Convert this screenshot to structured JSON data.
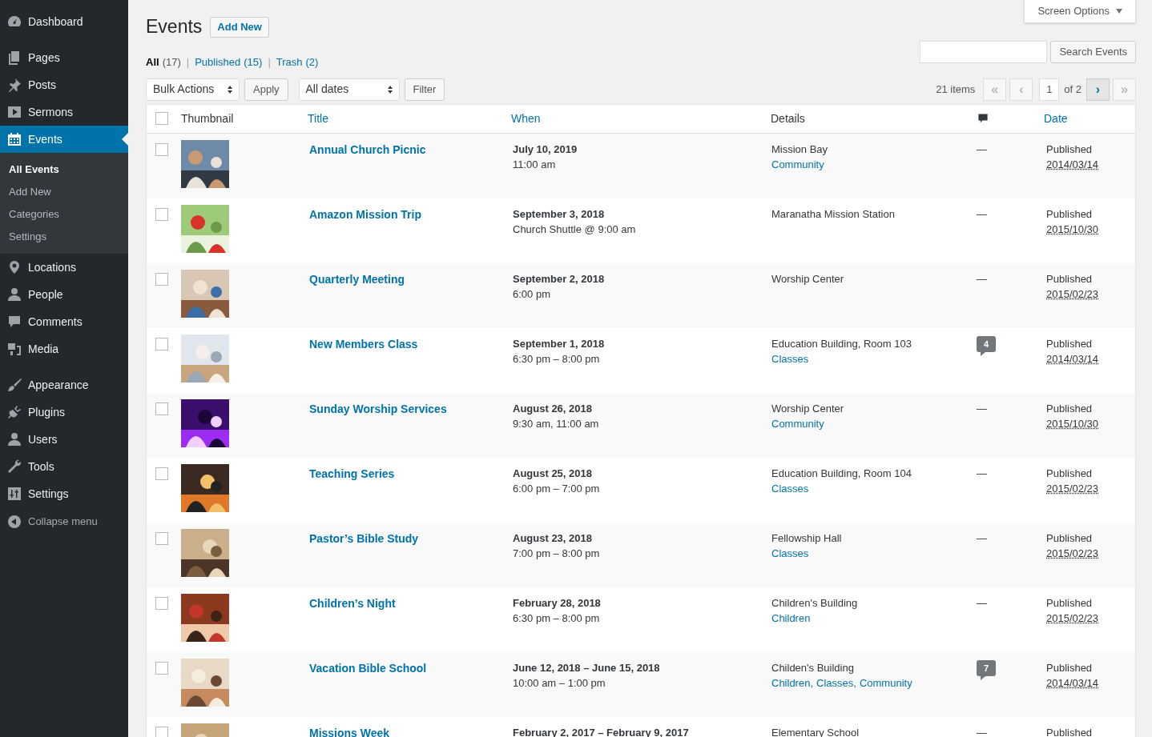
{
  "sidebar": {
    "groups": [
      [
        {
          "label": "Dashboard",
          "selected": false
        }
      ],
      [
        {
          "label": "Pages",
          "selected": false
        },
        {
          "label": "Posts",
          "selected": false
        },
        {
          "label": "Sermons",
          "selected": false
        },
        {
          "label": "Events",
          "selected": true,
          "submenu": [
            {
              "label": "All Events",
              "selected": true
            },
            {
              "label": "Add New",
              "selected": false
            },
            {
              "label": "Categories",
              "selected": false
            },
            {
              "label": "Settings",
              "selected": false
            }
          ]
        },
        {
          "label": "Locations",
          "selected": false
        },
        {
          "label": "People",
          "selected": false
        },
        {
          "label": "Comments",
          "selected": false
        },
        {
          "label": "Media",
          "selected": false
        }
      ],
      [
        {
          "label": "Appearance",
          "selected": false
        },
        {
          "label": "Plugins",
          "selected": false
        },
        {
          "label": "Users",
          "selected": false
        },
        {
          "label": "Tools",
          "selected": false
        },
        {
          "label": "Settings",
          "selected": false
        }
      ]
    ],
    "collapse": "Collapse menu"
  },
  "screen_options": "Screen Options",
  "title": "Events",
  "add_new": "Add New",
  "views": [
    {
      "label": "All",
      "count": "(17)",
      "selected": true,
      "separator": "|"
    },
    {
      "label": "Published",
      "count": "(15)",
      "selected": false,
      "separator": "|"
    },
    {
      "label": "Trash",
      "count": "(2)",
      "selected": false
    }
  ],
  "select_all_checked": false,
  "search_button": "Search Events",
  "bulk_actions": "Bulk Actions",
  "apply": "Apply",
  "dates": "All dates",
  "filter": "Filter",
  "pagination": {
    "items": "21 items",
    "page": "1",
    "of": "of 2",
    "buttons": [
      {
        "label": "«",
        "disabled": true
      },
      {
        "label": "‹",
        "disabled": true
      },
      {
        "label": "›",
        "disabled": false
      },
      {
        "label": "»",
        "disabled": true
      }
    ]
  },
  "columns": {
    "thumbnail": "Thumbnail",
    "title": "Title",
    "when": "When",
    "details": "Details",
    "date": "Date"
  },
  "rows": [
    {
      "checked": false,
      "title": "Annual Church Picnic",
      "when": [
        "July 10, 2019",
        "11:00 am"
      ],
      "location": "Mission Bay",
      "categories": [
        {
          "label": "Community"
        }
      ],
      "comments": {
        "kind": "dash",
        "text": "—"
      },
      "status": "Published",
      "date": "2014/03/14"
    },
    {
      "checked": false,
      "title": "Amazon Mission Trip",
      "when": [
        "September 3, 2018",
        "Church Shuttle @ 9:00 am"
      ],
      "location": "Maranatha Mission Station",
      "categories": [],
      "comments": {
        "kind": "dash",
        "text": "—"
      },
      "status": "Published",
      "date": "2015/10/30"
    },
    {
      "checked": false,
      "title": "Quarterly Meeting",
      "when": [
        "September 2, 2018",
        "6:00 pm"
      ],
      "location": "Worship Center",
      "categories": [],
      "comments": {
        "kind": "dash",
        "text": "—"
      },
      "status": "Published",
      "date": "2015/02/23"
    },
    {
      "checked": false,
      "title": "New Members Class",
      "when": [
        "September 1, 2018",
        "6:30 pm – 8:00 pm"
      ],
      "location": "Education Building, Room 103",
      "categories": [
        {
          "label": "Classes"
        }
      ],
      "comments": {
        "kind": "bubble",
        "text": "4"
      },
      "status": "Published",
      "date": "2014/03/14"
    },
    {
      "checked": false,
      "title": "Sunday Worship Services",
      "when": [
        "August 26, 2018",
        "9:30 am, 11:00 am"
      ],
      "location": "Worship Center",
      "categories": [
        {
          "label": "Community"
        }
      ],
      "comments": {
        "kind": "dash",
        "text": "—"
      },
      "status": "Published",
      "date": "2015/10/30"
    },
    {
      "checked": false,
      "title": "Teaching Series",
      "when": [
        "August 25, 2018",
        "6:00 pm – 7:00 pm"
      ],
      "location": "Education Building, Room 104",
      "categories": [
        {
          "label": "Classes"
        }
      ],
      "comments": {
        "kind": "dash",
        "text": "—"
      },
      "status": "Published",
      "date": "2015/02/23"
    },
    {
      "checked": false,
      "title": "Pastor’s Bible Study",
      "when": [
        "August 23, 2018",
        "7:00 pm – 8:00 pm"
      ],
      "location": "Fellowship Hall",
      "categories": [
        {
          "label": "Classes"
        }
      ],
      "comments": {
        "kind": "dash",
        "text": "—"
      },
      "status": "Published",
      "date": "2015/02/23"
    },
    {
      "checked": false,
      "title": "Children’s Night",
      "when": [
        "February 28, 2018",
        "6:30 pm – 8:00 pm"
      ],
      "location": "Children's Building",
      "categories": [
        {
          "label": "Children"
        }
      ],
      "comments": {
        "kind": "dash",
        "text": "—"
      },
      "status": "Published",
      "date": "2015/02/23"
    },
    {
      "checked": false,
      "title": "Vacation Bible School",
      "when": [
        "June 12, 2018 – June 15, 2018",
        "10:00 am – 1:00 pm"
      ],
      "location": "Childen's Building",
      "categories": [
        {
          "label": "Children",
          "separator": ","
        },
        {
          "label": "Classes",
          "separator": ","
        },
        {
          "label": "Community"
        }
      ],
      "comments": {
        "kind": "bubble",
        "text": "7"
      },
      "status": "Published",
      "date": "2014/03/14"
    },
    {
      "checked": false,
      "title": "Missions Week",
      "when": [
        "February 2, 2017 – February 9, 2017"
      ],
      "location": "Elementary School",
      "categories": [],
      "comments": {
        "kind": "dash",
        "text": "—"
      },
      "status": "Published"
    }
  ]
}
